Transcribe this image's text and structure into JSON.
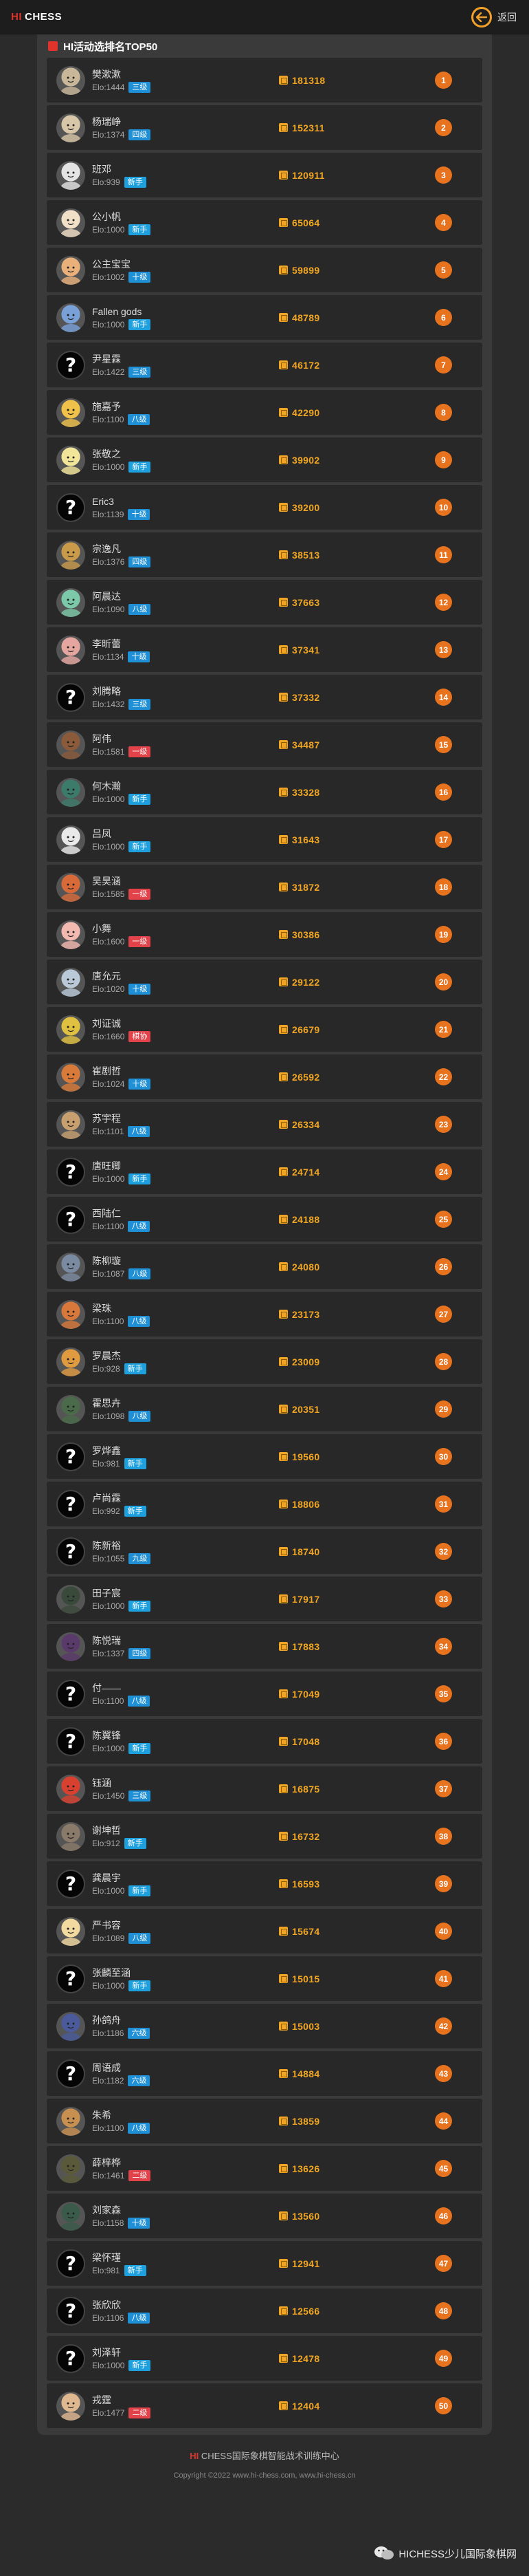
{
  "header": {
    "logo_hi": "HI",
    "logo_chess": "CHESS",
    "back_label": "返回",
    "accent": "#f2a02a"
  },
  "panel": {
    "title": "HI活动选排名TOP50"
  },
  "levels": {
    "三级": "#1f8fd6",
    "四级": "#1f8fd6",
    "新手": "#1fa0de",
    "十级": "#1f8fd6",
    "八级": "#1f8fd6",
    "六级": "#1f8fd6",
    "一级": "#e2434a",
    "二级": "#e2434a",
    "棋协": "#e2434a"
  },
  "players": [
    {
      "rank": "1",
      "name": "樊漱漱",
      "elo": "Elo:1444",
      "level": "三级",
      "score": "181318",
      "avatar": "photo",
      "color": "#c9b79a"
    },
    {
      "rank": "2",
      "name": "杨瑞峥",
      "elo": "Elo:1374",
      "level": "四级",
      "score": "152311",
      "avatar": "photo",
      "color": "#d8c6a8"
    },
    {
      "rank": "3",
      "name": "班邓",
      "elo": "Elo:939",
      "level": "新手",
      "score": "120911",
      "avatar": "photo",
      "color": "#e4e4e4"
    },
    {
      "rank": "4",
      "name": "公小帆",
      "elo": "Elo:1000",
      "level": "新手",
      "score": "65064",
      "avatar": "photo",
      "color": "#f1e0c8"
    },
    {
      "rank": "5",
      "name": "公主宝宝",
      "elo": "Elo:1002",
      "level": "十级",
      "score": "59899",
      "avatar": "photo",
      "color": "#e9b07a"
    },
    {
      "rank": "6",
      "name": "Fallen gods",
      "elo": "Elo:1000",
      "level": "新手",
      "score": "48789",
      "avatar": "photo",
      "color": "#7aa0d8"
    },
    {
      "rank": "7",
      "name": "尹星霖",
      "elo": "Elo:1422",
      "level": "三级",
      "score": "46172",
      "avatar": "unknown"
    },
    {
      "rank": "8",
      "name": "施嘉予",
      "elo": "Elo:1100",
      "level": "八级",
      "score": "42290",
      "avatar": "photo",
      "color": "#f0c24a"
    },
    {
      "rank": "9",
      "name": "张敬之",
      "elo": "Elo:1000",
      "level": "新手",
      "score": "39902",
      "avatar": "photo",
      "color": "#f1e59a"
    },
    {
      "rank": "10",
      "name": "Eric3",
      "elo": "Elo:1139",
      "level": "十级",
      "score": "39200",
      "avatar": "unknown"
    },
    {
      "rank": "11",
      "name": "宗逸凡",
      "elo": "Elo:1376",
      "level": "四级",
      "score": "38513",
      "avatar": "photo",
      "color": "#c99a4a"
    },
    {
      "rank": "12",
      "name": "阿晨达",
      "elo": "Elo:1090",
      "level": "八级",
      "score": "37663",
      "avatar": "photo",
      "color": "#7bc9a8"
    },
    {
      "rank": "13",
      "name": "李昕蕾",
      "elo": "Elo:1134",
      "level": "十级",
      "score": "37341",
      "avatar": "photo",
      "color": "#e6a6a0"
    },
    {
      "rank": "14",
      "name": "刘腾略",
      "elo": "Elo:1432",
      "level": "三级",
      "score": "37332",
      "avatar": "unknown"
    },
    {
      "rank": "15",
      "name": "阿伟",
      "elo": "Elo:1581",
      "level": "一级",
      "score": "34487",
      "avatar": "photo",
      "color": "#8a5a3a"
    },
    {
      "rank": "16",
      "name": "何木瀚",
      "elo": "Elo:1000",
      "level": "新手",
      "score": "33328",
      "avatar": "photo",
      "color": "#3c7a6a"
    },
    {
      "rank": "17",
      "name": "吕凤",
      "elo": "Elo:1000",
      "level": "新手",
      "score": "31643",
      "avatar": "photo",
      "color": "#e9e9e9"
    },
    {
      "rank": "18",
      "name": "吴昊涵",
      "elo": "Elo:1585",
      "level": "一级",
      "score": "31872",
      "avatar": "photo",
      "color": "#d86a3a"
    },
    {
      "rank": "19",
      "name": "小舞",
      "elo": "Elo:1600",
      "level": "一级",
      "score": "30386",
      "avatar": "photo",
      "color": "#f2b9b0"
    },
    {
      "rank": "20",
      "name": "唐允元",
      "elo": "Elo:1020",
      "level": "十级",
      "score": "29122",
      "avatar": "photo",
      "color": "#b9c9d8"
    },
    {
      "rank": "21",
      "name": "刘证诚",
      "elo": "Elo:1660",
      "level": "棋协",
      "score": "26679",
      "avatar": "photo",
      "color": "#e0c040"
    },
    {
      "rank": "22",
      "name": "崔剧哲",
      "elo": "Elo:1024",
      "level": "十级",
      "score": "26592",
      "avatar": "photo",
      "color": "#d87a3a"
    },
    {
      "rank": "23",
      "name": "苏宇程",
      "elo": "Elo:1101",
      "level": "八级",
      "score": "26334",
      "avatar": "photo",
      "color": "#c8a070"
    },
    {
      "rank": "24",
      "name": "唐旺卿",
      "elo": "Elo:1000",
      "level": "新手",
      "score": "24714",
      "avatar": "unknown"
    },
    {
      "rank": "25",
      "name": "西陆仁",
      "elo": "Elo:1100",
      "level": "八级",
      "score": "24188",
      "avatar": "unknown"
    },
    {
      "rank": "26",
      "name": "陈柳璇",
      "elo": "Elo:1087",
      "level": "八级",
      "score": "24080",
      "avatar": "photo",
      "color": "#7a8aa0"
    },
    {
      "rank": "27",
      "name": "梁珠",
      "elo": "Elo:1100",
      "level": "八级",
      "score": "23173",
      "avatar": "photo",
      "color": "#d8783a"
    },
    {
      "rank": "28",
      "name": "罗晨杰",
      "elo": "Elo:928",
      "level": "新手",
      "score": "23009",
      "avatar": "photo",
      "color": "#e09a40"
    },
    {
      "rank": "29",
      "name": "霍思卉",
      "elo": "Elo:1098",
      "level": "八级",
      "score": "20351",
      "avatar": "photo",
      "color": "#4a6a4a"
    },
    {
      "rank": "30",
      "name": "罗烨鑫",
      "elo": "Elo:981",
      "level": "新手",
      "score": "19560",
      "avatar": "unknown"
    },
    {
      "rank": "31",
      "name": "卢尚霖",
      "elo": "Elo:992",
      "level": "新手",
      "score": "18806",
      "avatar": "unknown"
    },
    {
      "rank": "32",
      "name": "陈新裕",
      "elo": "Elo:1055",
      "level": "九级",
      "score": "18740",
      "avatar": "unknown"
    },
    {
      "rank": "33",
      "name": "田子宸",
      "elo": "Elo:1000",
      "level": "新手",
      "score": "17917",
      "avatar": "photo",
      "color": "#3a4a3a"
    },
    {
      "rank": "34",
      "name": "陈悦瑞",
      "elo": "Elo:1337",
      "level": "四级",
      "score": "17883",
      "avatar": "photo",
      "color": "#5a3a6a"
    },
    {
      "rank": "35",
      "name": "付——",
      "elo": "Elo:1100",
      "level": "八级",
      "score": "17049",
      "avatar": "unknown"
    },
    {
      "rank": "36",
      "name": "陈翼锋",
      "elo": "Elo:1000",
      "level": "新手",
      "score": "17048",
      "avatar": "unknown"
    },
    {
      "rank": "37",
      "name": "钰涵",
      "elo": "Elo:1450",
      "level": "三级",
      "score": "16875",
      "avatar": "photo",
      "color": "#d84030"
    },
    {
      "rank": "38",
      "name": "谢坤哲",
      "elo": "Elo:912",
      "level": "新手",
      "score": "16732",
      "avatar": "photo",
      "color": "#8a7a6a"
    },
    {
      "rank": "39",
      "name": "龚晨宇",
      "elo": "Elo:1000",
      "level": "新手",
      "score": "16593",
      "avatar": "unknown"
    },
    {
      "rank": "40",
      "name": "严书容",
      "elo": "Elo:1089",
      "level": "八级",
      "score": "15674",
      "avatar": "photo",
      "color": "#f2d9a0"
    },
    {
      "rank": "41",
      "name": "张麟至涵",
      "elo": "Elo:1000",
      "level": "新手",
      "score": "15015",
      "avatar": "unknown"
    },
    {
      "rank": "42",
      "name": "孙鸽舟",
      "elo": "Elo:1186",
      "level": "六级",
      "score": "15003",
      "avatar": "photo",
      "color": "#4a5a9a"
    },
    {
      "rank": "43",
      "name": "周语成",
      "elo": "Elo:1182",
      "level": "六级",
      "score": "14884",
      "avatar": "unknown"
    },
    {
      "rank": "44",
      "name": "朱希",
      "elo": "Elo:1100",
      "level": "八级",
      "score": "13859",
      "avatar": "photo",
      "color": "#c89050"
    },
    {
      "rank": "45",
      "name": "薛梓桦",
      "elo": "Elo:1461",
      "level": "二级",
      "score": "13626",
      "avatar": "photo",
      "color": "#5a5a3a"
    },
    {
      "rank": "46",
      "name": "刘家森",
      "elo": "Elo:1158",
      "level": "十级",
      "score": "13560",
      "avatar": "photo",
      "color": "#3a5a4a"
    },
    {
      "rank": "47",
      "name": "梁怀瑾",
      "elo": "Elo:981",
      "level": "新手",
      "score": "12941",
      "avatar": "unknown"
    },
    {
      "rank": "48",
      "name": "张欣欣",
      "elo": "Elo:1106",
      "level": "八级",
      "score": "12566",
      "avatar": "unknown"
    },
    {
      "rank": "49",
      "name": "刘泽轩",
      "elo": "Elo:1000",
      "level": "新手",
      "score": "12478",
      "avatar": "unknown"
    },
    {
      "rank": "50",
      "name": "戎霆",
      "elo": "Elo:1477",
      "level": "二级",
      "score": "12404",
      "avatar": "photo",
      "color": "#e0b890"
    }
  ],
  "footer": {
    "brand_hi": "HI",
    "brand_rest": "CHESS国际象棋智能战术训练中心",
    "copyright": "Copyright ©2022 www.hi-chess.com, www.hi-chess.cn"
  },
  "watermark": {
    "text": "HICHESS少儿国际象棋网"
  }
}
